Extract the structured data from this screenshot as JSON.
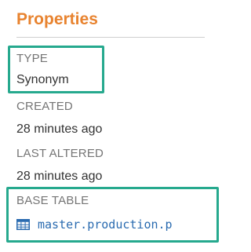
{
  "properties": {
    "heading": "Properties",
    "type": {
      "label": "TYPE",
      "value": "Synonym"
    },
    "created": {
      "label": "CREATED",
      "value": "28 minutes ago"
    },
    "last_altered": {
      "label": "LAST ALTERED",
      "value": "28 minutes ago"
    },
    "base_table": {
      "label": "BASE TABLE",
      "icon": "table-icon",
      "link_text": "master.production.p"
    }
  },
  "colors": {
    "heading": "#e8832f",
    "highlight": "#26a98e",
    "link": "#2a6bb0",
    "label": "#757575",
    "value": "#333333"
  }
}
